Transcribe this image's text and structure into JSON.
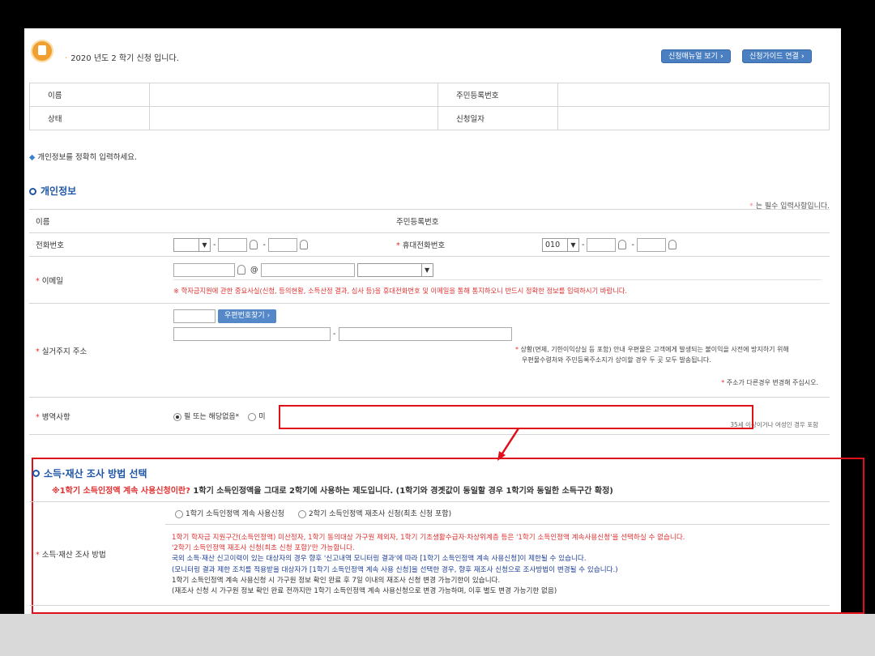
{
  "header": {
    "notice": "2020 년도 2 학기 신청 입니다.",
    "buttons": [
      "신청매뉴얼 보기",
      "신청가이드 연결"
    ]
  },
  "summary": {
    "rows": [
      {
        "label1": "이름",
        "label2": "주민등록번호"
      },
      {
        "label1": "상태",
        "label2": "신청일자"
      }
    ]
  },
  "hint": "개인정보를 정확히 입력하세요.",
  "personal": {
    "title": "개인정보",
    "required_note": "는 필수 입력사항입니다.",
    "name_label": "이름",
    "rrn_label": "주민등록번호",
    "phone_label": "전화번호",
    "mobile_label": "휴대전화번호",
    "mobile_prefix": "010",
    "email_label": "이메일",
    "email_at": "@",
    "email_notice": "※ 학자금지원에 관한 중요사실(신청, 등의현황, 소득산정 결과, 심사 등)을 휴대전화번호 및 이메일을 통해 통지하오니 반드시 정확한 정보를 입력하시기 바랍니다.",
    "address_label": "실거주지 주소",
    "zip_button": "우편번호찾기",
    "address_dash": "-",
    "address_note1": "상황(면제, 기한이익상실 등 포함) 안내 우편물은 고객에게 발생되는 불이익을 사전에 방지하기 위해",
    "address_note2": "우편물수령처와 주민등록주소지가 상이할 경우 두 곳 모두 발송됩니다.",
    "address_note3": "주소가 다른경우 변경해 주십시오.",
    "military_label": "병역사항",
    "military_opt1": "필 또는 해당없음*",
    "military_opt2": "미",
    "military_note": "35세 이상이거나 여성인 경우 포함"
  },
  "income": {
    "title": "소득·재산 조사 방법 선택",
    "sub_red": "※1학기 소득인정액 계속 사용신청이란?",
    "sub_black": " 1학기 소득인정액을 그대로 2학기에 사용하는 제도입니다. (1학기와 경곗값이 동일할 경우 1학기와 동일한 소득구간 확정)",
    "label": "소득·재산 조사 방법",
    "option1": "1학기 소득인정액 계속 사용신청",
    "option2": "2학기 소득인정액 재조사 신청(최초 신청 포함)",
    "lines": [
      "1학기 학자금 지원구간(소득인정액) 미산정자, 1학기 동의대상 가구원 제외자, 1학기 기초생활수급자·차상위계층 등은 '1학기 소득인정액 계속사용신청'을 선택하실 수 없습니다.",
      "'2학기 소득인정액 재조사 신청(최초 신청 포함)'만 가능합니다.",
      "국외 소득·재산 신고이력이 있는 대상자의 경우 향후 '신고내역 모니터링 결과'에 따라 [1학기 소득인정액 계속 사용신청]이 제한될 수 있습니다.",
      "(모니터링 결과 제한 조치를 적용받을 대상자가 [1학기 소득인정액 계속 사용 신청]을 선택한 경우, 향후 재조사 신청으로 조사방법이 변경될 수 있습니다.)",
      "1학기 소득인정액 계속 사용신청 시 가구원 정보 확인 완료 후 7일 이내의 재조사 신청 변경 가능기한이 있습니다.",
      "(재조사 신청 시 가구원 정보 확인 완료 전까지만 1학기 소득인정액 계속 사용신청으로 변경 가능하며, 이후 별도 변경 가능기한 없음)"
    ]
  },
  "colors": {
    "accent": "#1f56a8",
    "highlight": "#e0101b",
    "button": "#4a7fc1"
  }
}
